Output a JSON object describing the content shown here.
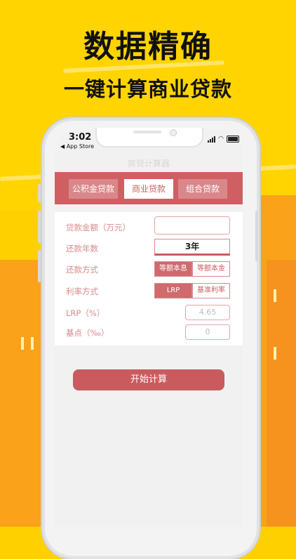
{
  "promo": {
    "headline": "数据精确",
    "subhead": "一键计算商业贷款"
  },
  "status_bar": {
    "time": "3:02",
    "back_label": "◀ App Store"
  },
  "app": {
    "title": "房贷计算器",
    "tabs": [
      {
        "label": "公积金贷款",
        "active": false
      },
      {
        "label": "商业贷款",
        "active": true
      },
      {
        "label": "组合贷款",
        "active": false
      }
    ],
    "form": {
      "amount_label": "贷款金额（万元）",
      "amount_value": "",
      "years_label": "还款年数",
      "years_value": "3年",
      "method_label": "还款方式",
      "method_options": [
        "等额本息",
        "等额本金"
      ],
      "method_selected": "等额本息",
      "rate_label": "利率方式",
      "rate_options": [
        "LRP",
        "基准利率"
      ],
      "rate_selected": "LRP",
      "lrp_label": "LRP（%）",
      "lrp_placeholder": "4.65",
      "bp_label": "基点（‰）",
      "bp_placeholder": "0"
    },
    "calc_button": "开始计算"
  },
  "colors": {
    "background": "#ffd000",
    "accent": "#cf5f63",
    "label": "#d9898b"
  }
}
